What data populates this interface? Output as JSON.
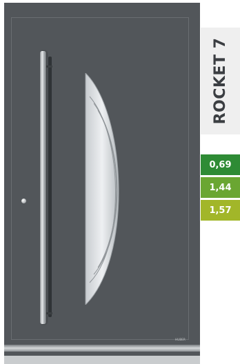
{
  "product": {
    "model_name": "ROCKET 7",
    "brand_mark": "HUBER"
  },
  "u_values": [
    {
      "value": "0,69",
      "color": "#2e8b35"
    },
    {
      "value": "1,44",
      "color": "#6aa632"
    },
    {
      "value": "1,57",
      "color": "#a2b629"
    }
  ],
  "colors": {
    "door": "#52565a",
    "glass_edge": "#dfe3e6"
  }
}
